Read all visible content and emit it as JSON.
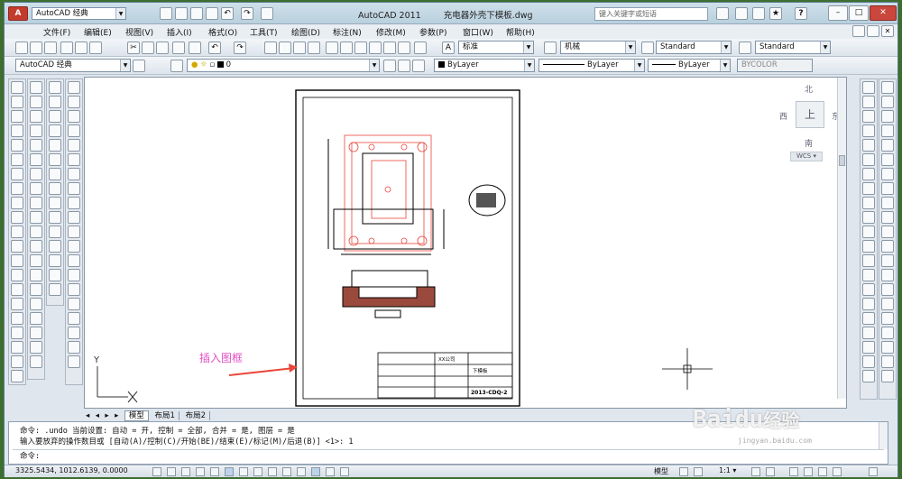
{
  "app": {
    "workspace": "AutoCAD 经典",
    "title": "AutoCAD 2011",
    "filename": "充电器外壳下模板.dwg",
    "search_placeholder": "键入关键字或短语"
  },
  "menu": [
    "文件(F)",
    "编辑(E)",
    "视图(V)",
    "插入(I)",
    "格式(O)",
    "工具(T)",
    "绘图(D)",
    "标注(N)",
    "修改(M)",
    "参数(P)",
    "窗口(W)",
    "帮助(H)"
  ],
  "styles": {
    "text_style": "标准",
    "dim_style": "机械",
    "table_style": "Standard",
    "multileader_style": "Standard"
  },
  "layers": {
    "workspace_combo": "AutoCAD 经典",
    "current_layer": "0",
    "color": "ByLayer",
    "linetype": "ByLayer",
    "lineweight": "ByLayer",
    "plotstyle": "BYCOLOR"
  },
  "viewcube": {
    "north": "北",
    "south": "南",
    "east": "东",
    "west": "西",
    "face": "上",
    "ucs": "WCS"
  },
  "annotation": {
    "text": "插入图框",
    "color": "#e34fc3"
  },
  "title_block": {
    "part_name": "下模板",
    "drawing_no": "2013-CDQ-2",
    "company": "XX公司"
  },
  "tabs": [
    "模型",
    "布局1",
    "布局2"
  ],
  "command": {
    "line1": "命令:  .undo 当前设置: 自动 = 开, 控制 = 全部, 合并 = 是, 图层 = 是",
    "line2": "输入要放弃的操作数目或 [自动(A)/控制(C)/开始(BE)/结束(E)/标记(M)/后退(B)] <1>: 1",
    "prompt": "命令:"
  },
  "status": {
    "coords": "3325.5434,  1012.6139,  0.0000",
    "model": "模型",
    "scale": "1:1"
  },
  "watermark": {
    "brand": "Baidu",
    "brand_cn": "经验",
    "url": "jingyan.baidu.com"
  },
  "colors": {
    "cad_red": "#e8463a",
    "accent_blue": "#2b5fa8"
  }
}
